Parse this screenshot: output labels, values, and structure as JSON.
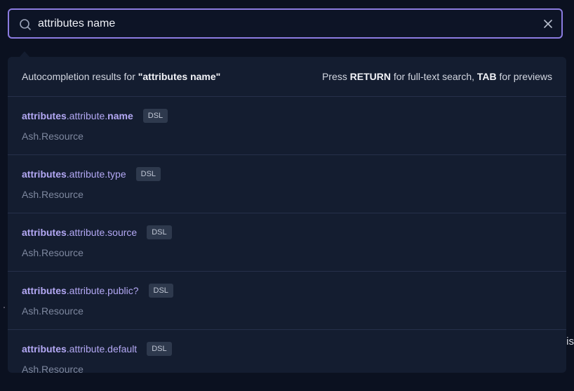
{
  "search": {
    "value": "attributes name"
  },
  "header": {
    "prefix": "Autocompletion results for ",
    "query": "\"attributes name\"",
    "hint_press": "Press ",
    "hint_return": "RETURN",
    "hint_middle": " for full-text search, ",
    "hint_tab": "TAB",
    "hint_end": " for previews"
  },
  "results": [
    {
      "key": "attributes",
      "rest": ".attribute.",
      "name": "name",
      "badge": "DSL",
      "module": "Ash.Resource"
    },
    {
      "key": "attributes",
      "rest": ".attribute.type",
      "name": "",
      "badge": "DSL",
      "module": "Ash.Resource"
    },
    {
      "key": "attributes",
      "rest": ".attribute.source",
      "name": "",
      "badge": "DSL",
      "module": "Ash.Resource"
    },
    {
      "key": "attributes",
      "rest": ".attribute.public?",
      "name": "",
      "badge": "DSL",
      "module": "Ash.Resource"
    },
    {
      "key": "attributes",
      "rest": ".attribute.default",
      "name": "",
      "badge": "DSL",
      "module": "Ash.Resource"
    }
  ],
  "background": {
    "glyph": "is"
  },
  "colors": {
    "accent": "#8b7be0",
    "highlight": "#b3a8f4",
    "panel": "#141d30",
    "page": "#0b1120"
  }
}
